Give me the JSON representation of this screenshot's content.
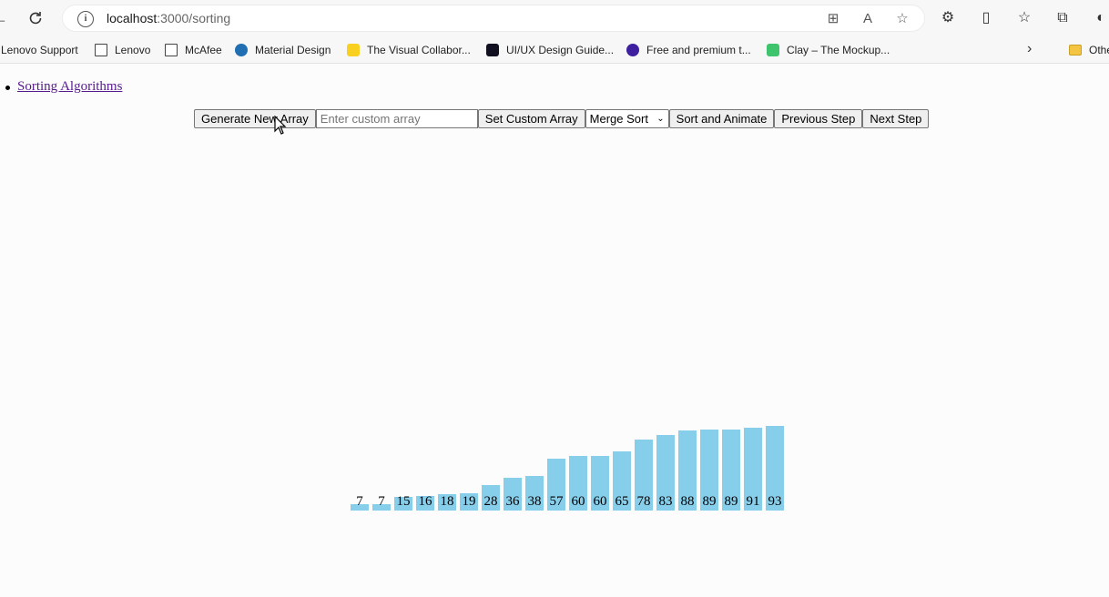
{
  "browser": {
    "url_host": "localhost",
    "url_path": ":3000/sorting",
    "bookmarks": [
      {
        "label": "Lenovo Support",
        "icon": "none"
      },
      {
        "label": "Lenovo",
        "icon": "page-icon"
      },
      {
        "label": "McAfee",
        "icon": "page-icon"
      },
      {
        "label": "Material Design",
        "icon": "material-design-icon",
        "color": "#1f6fb2"
      },
      {
        "label": "The Visual Collabor...",
        "icon": "miro-icon",
        "color": "#f9d020"
      },
      {
        "label": "UI/UX Design Guide...",
        "icon": "uiux-icon",
        "color": "#101020"
      },
      {
        "label": "Free and premium t...",
        "icon": "free-premium-icon",
        "color": "#3d1fa0"
      },
      {
        "label": "Clay – The Mockup...",
        "icon": "clay-icon",
        "color": "#3ec46d"
      }
    ],
    "other_label": "Othe"
  },
  "page": {
    "nav_link": "Sorting Algorithms",
    "buttons": {
      "generate": "Generate New Array",
      "set_custom": "Set Custom Array",
      "sort_animate": "Sort and Animate",
      "previous": "Previous Step",
      "next": "Next Step"
    },
    "custom_input_placeholder": "Enter custom array",
    "algorithm_selected": "Merge Sort",
    "bar_color": "#87ceeb"
  },
  "chart_data": {
    "type": "bar",
    "values": [
      7,
      7,
      15,
      16,
      18,
      19,
      28,
      36,
      38,
      57,
      60,
      60,
      65,
      78,
      83,
      88,
      89,
      89,
      91,
      93
    ]
  }
}
